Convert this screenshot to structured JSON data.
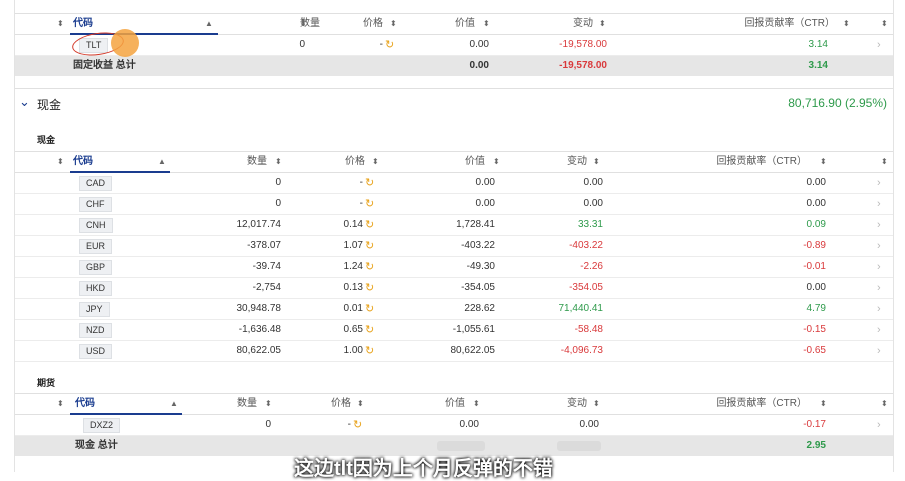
{
  "headers": {
    "code": "代码",
    "qty": "数量",
    "price": "价格",
    "value": "价值",
    "change": "变动",
    "ctr": "回报贡献率（CTR）"
  },
  "fixed_income": {
    "rows": [
      {
        "code": "TLT",
        "qty": "0",
        "price": "-",
        "value": "0.00",
        "change": "-19,578.00",
        "ctr": "3.14"
      }
    ],
    "total": {
      "label": "固定收益 总计",
      "value": "0.00",
      "change": "-19,578.00",
      "ctr": "3.14"
    }
  },
  "cash_section": {
    "title": "现金",
    "summary": "80,716.90 (2.95%)",
    "subtitle": "现金",
    "rows": [
      {
        "code": "CAD",
        "qty": "0",
        "price": "-",
        "value": "0.00",
        "change": "0.00",
        "ctr": "0.00"
      },
      {
        "code": "CHF",
        "qty": "0",
        "price": "-",
        "value": "0.00",
        "change": "0.00",
        "ctr": "0.00"
      },
      {
        "code": "CNH",
        "qty": "12,017.74",
        "price": "0.14",
        "value": "1,728.41",
        "change": "33.31",
        "ctr": "0.09"
      },
      {
        "code": "EUR",
        "qty": "-378.07",
        "price": "1.07",
        "value": "-403.22",
        "change": "-403.22",
        "ctr": "-0.89"
      },
      {
        "code": "GBP",
        "qty": "-39.74",
        "price": "1.24",
        "value": "-49.30",
        "change": "-2.26",
        "ctr": "-0.01"
      },
      {
        "code": "HKD",
        "qty": "-2,754",
        "price": "0.13",
        "value": "-354.05",
        "change": "-354.05",
        "ctr": "0.00"
      },
      {
        "code": "JPY",
        "qty": "30,948.78",
        "price": "0.01",
        "value": "228.62",
        "change": "71,440.41",
        "ctr": "4.79"
      },
      {
        "code": "NZD",
        "qty": "-1,636.48",
        "price": "0.65",
        "value": "-1,055.61",
        "change": "-58.48",
        "ctr": "-0.15"
      },
      {
        "code": "USD",
        "qty": "80,622.05",
        "price": "1.00",
        "value": "80,622.05",
        "change": "-4,096.73",
        "ctr": "-0.65"
      }
    ]
  },
  "futures": {
    "subtitle": "期货",
    "rows": [
      {
        "code": "DXZ2",
        "qty": "0",
        "price": "-",
        "value": "0.00",
        "change": "0.00",
        "ctr": "-0.17"
      }
    ]
  },
  "cash_total": {
    "label": "现金 总计",
    "ctr": "2.95"
  },
  "caption": "这边tlt因为上个月反弹的不错",
  "colors": {
    "accent": "#1a3c8f",
    "positive": "#2e9a4b",
    "negative": "#d9393b",
    "clock": "#e8a21a"
  }
}
